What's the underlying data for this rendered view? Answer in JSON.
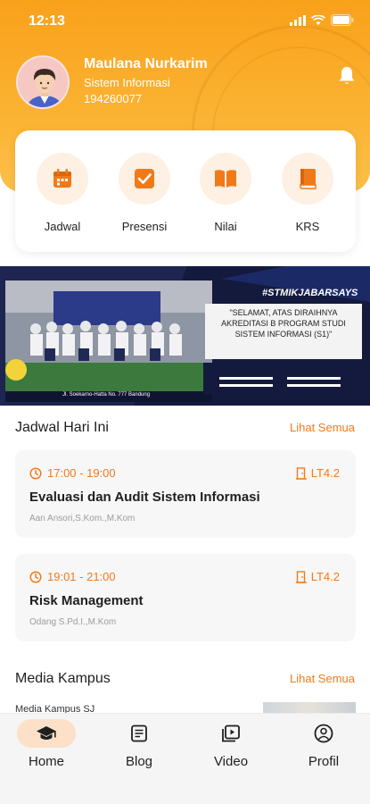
{
  "status_bar": {
    "time": "12:13"
  },
  "profile": {
    "name": "Maulana Nurkarim",
    "major": "Sistem Informasi",
    "nim": "194260077"
  },
  "menu": [
    {
      "label": "Jadwal",
      "icon": "calendar-icon"
    },
    {
      "label": "Presensi",
      "icon": "checkbox-icon"
    },
    {
      "label": "Nilai",
      "icon": "open-book-icon"
    },
    {
      "label": "KRS",
      "icon": "book-icon"
    }
  ],
  "banner": {
    "hashtag": "#STMIKJABARSAYS",
    "quote": "\"SELAMAT, ATAS DIRAIHNYA AKREDITASI B PROGRAM STUDI SISTEM INFORMASI (S1)\"",
    "address": "Jl. Soekarno-Hatta No. 777 Bandung"
  },
  "schedule": {
    "title": "Jadwal Hari Ini",
    "see_all": "Lihat Semua",
    "items": [
      {
        "time": "17:00 - 19:00",
        "room": "LT4.2",
        "course": "Evaluasi dan Audit Sistem Informasi",
        "lecturer": "Aan Ansori,S.Kom.,M.Kom"
      },
      {
        "time": "19:01 - 21:00",
        "room": "LT4.2",
        "course": "Risk Management",
        "lecturer": "Odang S.Pd.I.,M.Kom"
      }
    ]
  },
  "media": {
    "title": "Media Kampus",
    "see_all": "Lihat Semua",
    "first_item": "Media Kampus SJ"
  },
  "nav": [
    {
      "label": "Home",
      "icon": "graduation-cap-icon",
      "active": true
    },
    {
      "label": "Blog",
      "icon": "article-icon",
      "active": false
    },
    {
      "label": "Video",
      "icon": "video-icon",
      "active": false
    },
    {
      "label": "Profil",
      "icon": "user-icon",
      "active": false
    }
  ],
  "colors": {
    "accent": "#f07a1a",
    "header": "#fbb332",
    "icon_bg": "#fef0e2",
    "nav_active": "#fde0c8"
  }
}
